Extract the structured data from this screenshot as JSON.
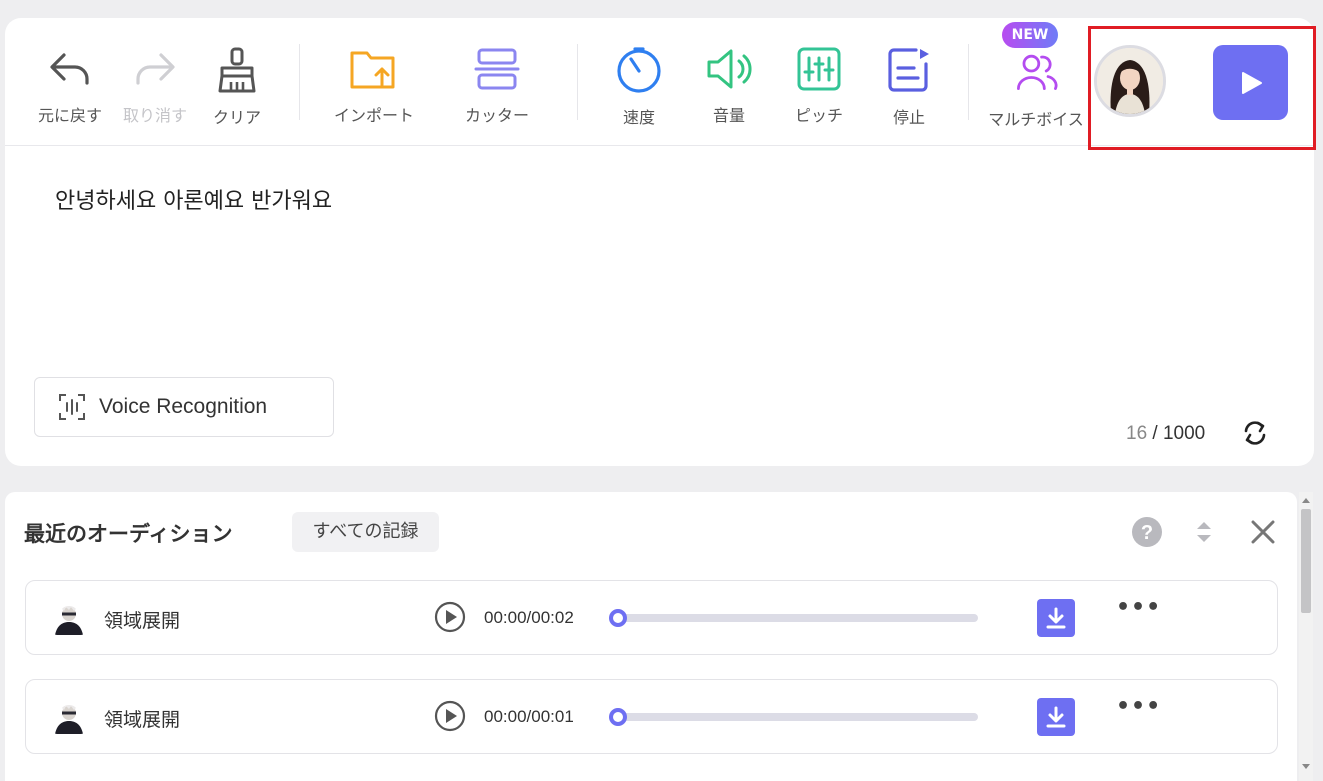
{
  "toolbar": {
    "undo": {
      "label": "元に戻す",
      "icon": "undo-icon"
    },
    "redo": {
      "label": "取り消す",
      "icon": "redo-icon"
    },
    "clear": {
      "label": "クリア",
      "icon": "broom-icon"
    },
    "import": {
      "label": "インポート",
      "icon": "folder-upload-icon"
    },
    "cutter": {
      "label": "カッター",
      "icon": "split-icon"
    },
    "speed": {
      "label": "速度",
      "icon": "speedometer-icon"
    },
    "volume": {
      "label": "音量",
      "icon": "speaker-icon"
    },
    "pitch": {
      "label": "ピッチ",
      "icon": "equalizer-icon"
    },
    "pause": {
      "label": "停止",
      "icon": "pause-note-icon"
    },
    "multivoice": {
      "label": "マルチボイス",
      "icon": "multi-voice-icon",
      "badge": "NEW"
    }
  },
  "editor": {
    "text": "안녕하세요 아론예요 반가워요",
    "voice_recognition_label": "Voice Recognition",
    "char_count": "16",
    "char_separator": " / ",
    "char_limit": "1000"
  },
  "history": {
    "title": "最近のオーディション",
    "all_records_label": "すべての記録",
    "items": [
      {
        "name": "領域展開",
        "time": "00:00/00:02",
        "progress": 0
      },
      {
        "name": "領域展開",
        "time": "00:00/00:01",
        "progress": 0
      }
    ]
  },
  "colors": {
    "accent": "#6e6ff2",
    "import_icon": "#f5a623",
    "cutter_icon": "#8b86f0",
    "speed_icon": "#2f7ff0",
    "volume_icon": "#33c481",
    "pitch_icon": "#33c496",
    "pause_icon": "#5a5fe0",
    "multivoice_icon": "#b44cf0",
    "highlight_box": "#e01c24"
  }
}
